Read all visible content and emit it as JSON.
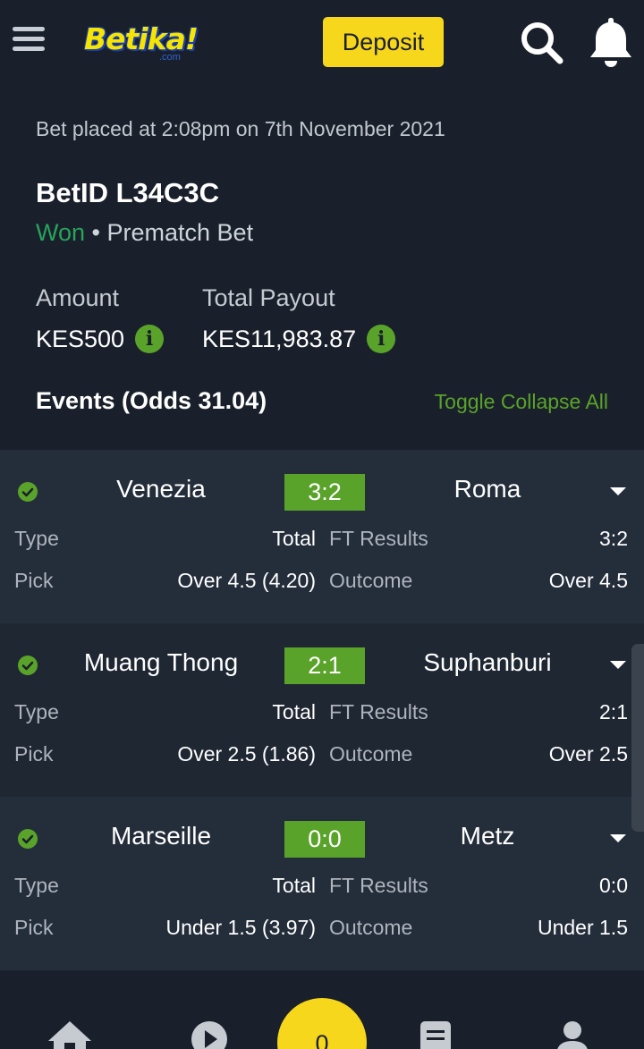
{
  "header": {
    "logo_text": "Betika!",
    "logo_sub": ".com",
    "deposit_label": "Deposit",
    "brand_yellow": "#f7d71c",
    "accent_green": "#5aa32a"
  },
  "bet": {
    "placed_text": "Bet placed at 2:08pm on 7th November 2021",
    "bet_id": "BetID L34C3C",
    "status": "Won",
    "separator": " • ",
    "bet_type": "Prematch Bet",
    "amount_label": "Amount",
    "amount_value": "KES500",
    "payout_label": "Total Payout",
    "payout_value": "KES11,983.87",
    "info_glyph": "i"
  },
  "events_header": {
    "title": "Events (Odds 31.04)",
    "toggle_label": "Toggle Collapse All"
  },
  "events": [
    {
      "home": "Venezia",
      "score": "3:2",
      "away": "Roma",
      "type_label": "Type",
      "type_value": "Total",
      "ft_label": "FT Results",
      "ft_value": "3:2",
      "pick_label": "Pick",
      "pick_value": "Over 4.5 (4.20)",
      "outcome_label": "Outcome",
      "outcome_value": "Over 4.5"
    },
    {
      "home": "Muang Thong",
      "score": "2:1",
      "away": "Suphanburi",
      "type_label": "Type",
      "type_value": "Total",
      "ft_label": "FT Results",
      "ft_value": "2:1",
      "pick_label": "Pick",
      "pick_value": "Over 2.5 (1.86)",
      "outcome_label": "Outcome",
      "outcome_value": "Over 2.5"
    },
    {
      "home": "Marseille",
      "score": "0:0",
      "away": "Metz",
      "type_label": "Type",
      "type_value": "Total",
      "ft_label": "FT Results",
      "ft_value": "0:0",
      "pick_label": "Pick",
      "pick_value": "Under 1.5 (3.97)",
      "outcome_label": "Outcome",
      "outcome_value": "Under 1.5"
    }
  ],
  "bottom_nav": {
    "betslip_count": "0",
    "icons": [
      "home-icon",
      "play-icon",
      "betslip-count",
      "receipt-icon",
      "profile-icon"
    ]
  }
}
